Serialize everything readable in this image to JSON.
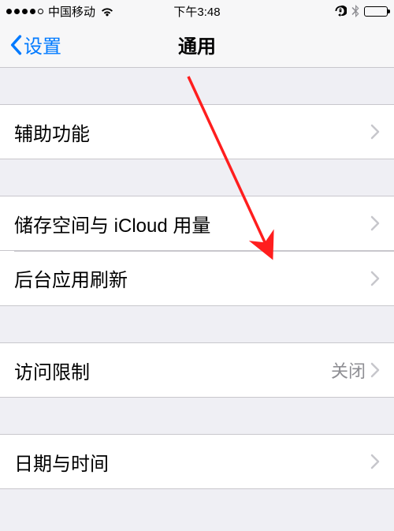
{
  "status": {
    "carrier": "中国移动",
    "time": "下午3:48"
  },
  "nav": {
    "back_label": "设置",
    "title": "通用"
  },
  "groups": [
    {
      "items": [
        {
          "key": "accessibility",
          "label": "辅助功能",
          "value": ""
        }
      ]
    },
    {
      "items": [
        {
          "key": "storage",
          "label": "储存空间与 iCloud 用量",
          "value": ""
        },
        {
          "key": "bg-refresh",
          "label": "后台应用刷新",
          "value": ""
        }
      ]
    },
    {
      "items": [
        {
          "key": "restrictions",
          "label": "访问限制",
          "value": "关闭"
        }
      ]
    },
    {
      "items": [
        {
          "key": "datetime",
          "label": "日期与时间",
          "value": ""
        }
      ]
    }
  ]
}
